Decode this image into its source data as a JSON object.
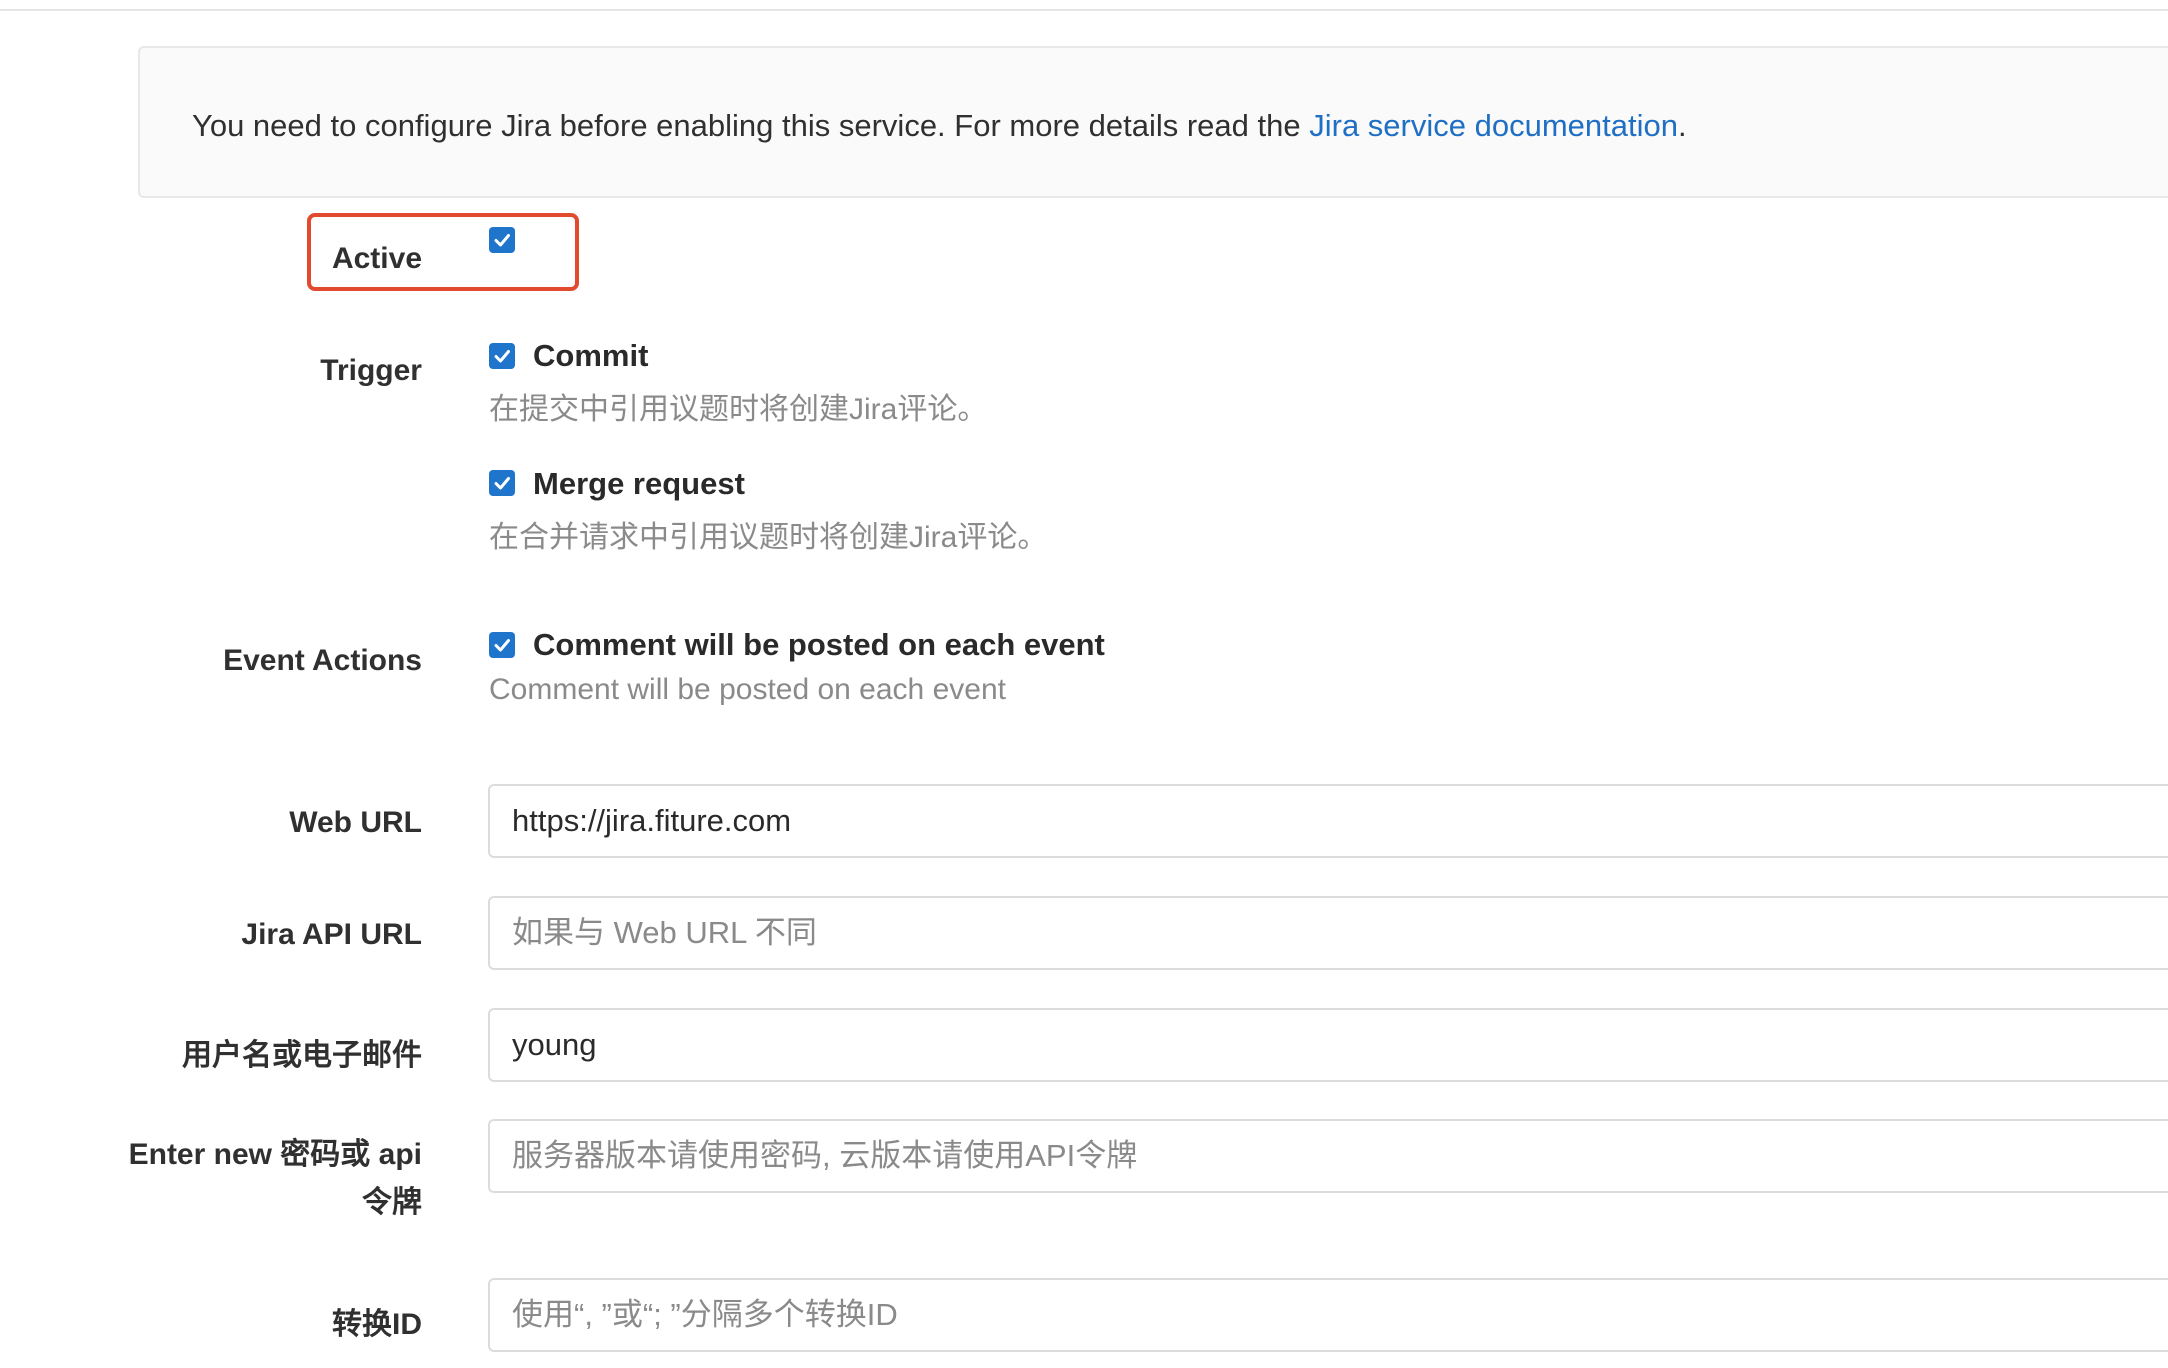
{
  "notice": {
    "text": "You need to configure Jira before enabling this service. For more details read the ",
    "link_text": "Jira service documentation",
    "suffix": "."
  },
  "active": {
    "label": "Active",
    "checked": true
  },
  "trigger": {
    "label": "Trigger",
    "commit": {
      "label": "Commit",
      "help": "在提交中引用议题时将创建Jira评论。",
      "checked": true
    },
    "merge_request": {
      "label": "Merge request",
      "help": "在合并请求中引用议题时将创建Jira评论。",
      "checked": true
    }
  },
  "event_actions": {
    "label": "Event Actions",
    "comment": {
      "label": "Comment will be posted on each event",
      "help": "Comment will be posted on each event",
      "checked": true
    }
  },
  "fields": {
    "web_url": {
      "label": "Web URL",
      "value": "https://jira.fiture.com",
      "placeholder": ""
    },
    "jira_api_url": {
      "label": "Jira API URL",
      "value": "",
      "placeholder": "如果与 Web URL 不同"
    },
    "username": {
      "label": "用户名或电子邮件",
      "value": "young",
      "placeholder": ""
    },
    "password": {
      "label": "Enter new 密码或 api 令牌",
      "value": "",
      "placeholder": "服务器版本请使用密码, 云版本请使用API令牌"
    },
    "transition_id": {
      "label": "转换ID",
      "value": "",
      "placeholder": "使用“, ”或“; ”分隔多个转换ID"
    }
  },
  "colors": {
    "accent": "#1f75cb",
    "link": "#1f6fc5",
    "highlight": "#e24a2e"
  },
  "icons": {
    "checkbox": "checkmark-icon"
  }
}
